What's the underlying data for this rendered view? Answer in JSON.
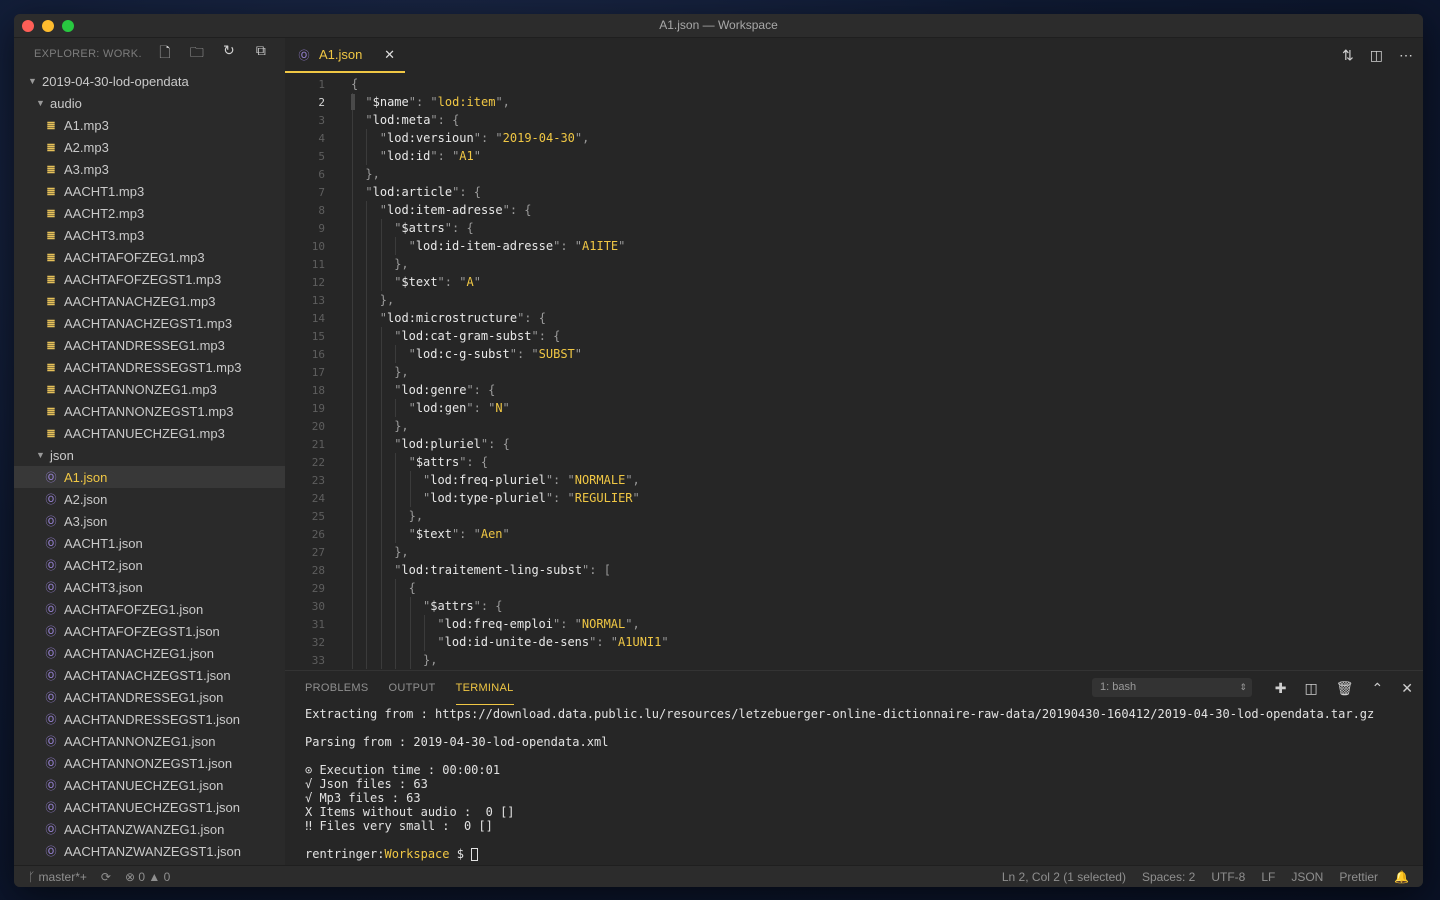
{
  "window": {
    "title": "A1.json — Workspace"
  },
  "sidebar": {
    "header": "EXPLORER: WORK...",
    "root": "2019-04-30-lod-opendata",
    "audio_folder": "audio",
    "audio_files": [
      "A1.mp3",
      "A2.mp3",
      "A3.mp3",
      "AACHT1.mp3",
      "AACHT2.mp3",
      "AACHT3.mp3",
      "AACHTAFOFZEG1.mp3",
      "AACHTAFOFZEGST1.mp3",
      "AACHTANACHZEG1.mp3",
      "AACHTANACHZEGST1.mp3",
      "AACHTANDRESSEG1.mp3",
      "AACHTANDRESSEGST1.mp3",
      "AACHTANNONZEG1.mp3",
      "AACHTANNONZEGST1.mp3",
      "AACHTANUECHZEG1.mp3"
    ],
    "json_folder": "json",
    "json_files": [
      "A1.json",
      "A2.json",
      "A3.json",
      "AACHT1.json",
      "AACHT2.json",
      "AACHT3.json",
      "AACHTAFOFZEG1.json",
      "AACHTAFOFZEGST1.json",
      "AACHTANACHZEG1.json",
      "AACHTANACHZEGST1.json",
      "AACHTANDRESSEG1.json",
      "AACHTANDRESSEGST1.json",
      "AACHTANNONZEG1.json",
      "AACHTANNONZEGST1.json",
      "AACHTANUECHZEG1.json",
      "AACHTANUECHZEGST1.json",
      "AACHTANZWANZEG1.json",
      "AACHTANZWANZEGST1.json"
    ],
    "active_file": "A1.json"
  },
  "editor": {
    "tab_label": "A1.json",
    "current_line": 2,
    "lines": [
      {
        "indent": 0,
        "parts": [
          [
            "p",
            "{"
          ]
        ]
      },
      {
        "indent": 1,
        "parts": [
          [
            "p",
            "\""
          ],
          [
            "k",
            "$name"
          ],
          [
            "p",
            "\": \""
          ],
          [
            "s",
            "lod:item"
          ],
          [
            "p",
            "\","
          ]
        ]
      },
      {
        "indent": 1,
        "parts": [
          [
            "p",
            "\""
          ],
          [
            "k",
            "lod:meta"
          ],
          [
            "p",
            "\": {"
          ]
        ]
      },
      {
        "indent": 2,
        "parts": [
          [
            "p",
            "\""
          ],
          [
            "k",
            "lod:versioun"
          ],
          [
            "p",
            "\": \""
          ],
          [
            "s",
            "2019-04-30"
          ],
          [
            "p",
            "\","
          ]
        ]
      },
      {
        "indent": 2,
        "parts": [
          [
            "p",
            "\""
          ],
          [
            "k",
            "lod:id"
          ],
          [
            "p",
            "\": \""
          ],
          [
            "s",
            "A1"
          ],
          [
            "p",
            "\""
          ]
        ]
      },
      {
        "indent": 1,
        "parts": [
          [
            "p",
            "},"
          ]
        ]
      },
      {
        "indent": 1,
        "parts": [
          [
            "p",
            "\""
          ],
          [
            "k",
            "lod:article"
          ],
          [
            "p",
            "\": {"
          ]
        ]
      },
      {
        "indent": 2,
        "parts": [
          [
            "p",
            "\""
          ],
          [
            "k",
            "lod:item-adresse"
          ],
          [
            "p",
            "\": {"
          ]
        ]
      },
      {
        "indent": 3,
        "parts": [
          [
            "p",
            "\""
          ],
          [
            "k",
            "$attrs"
          ],
          [
            "p",
            "\": {"
          ]
        ]
      },
      {
        "indent": 4,
        "parts": [
          [
            "p",
            "\""
          ],
          [
            "k",
            "lod:id-item-adresse"
          ],
          [
            "p",
            "\": \""
          ],
          [
            "s",
            "A1ITE"
          ],
          [
            "p",
            "\""
          ]
        ]
      },
      {
        "indent": 3,
        "parts": [
          [
            "p",
            "},"
          ]
        ]
      },
      {
        "indent": 3,
        "parts": [
          [
            "p",
            "\""
          ],
          [
            "k",
            "$text"
          ],
          [
            "p",
            "\": \""
          ],
          [
            "s",
            "A"
          ],
          [
            "p",
            "\""
          ]
        ]
      },
      {
        "indent": 2,
        "parts": [
          [
            "p",
            "},"
          ]
        ]
      },
      {
        "indent": 2,
        "parts": [
          [
            "p",
            "\""
          ],
          [
            "k",
            "lod:microstructure"
          ],
          [
            "p",
            "\": {"
          ]
        ]
      },
      {
        "indent": 3,
        "parts": [
          [
            "p",
            "\""
          ],
          [
            "k",
            "lod:cat-gram-subst"
          ],
          [
            "p",
            "\": {"
          ]
        ]
      },
      {
        "indent": 4,
        "parts": [
          [
            "p",
            "\""
          ],
          [
            "k",
            "lod:c-g-subst"
          ],
          [
            "p",
            "\": \""
          ],
          [
            "s",
            "SUBST"
          ],
          [
            "p",
            "\""
          ]
        ]
      },
      {
        "indent": 3,
        "parts": [
          [
            "p",
            "},"
          ]
        ]
      },
      {
        "indent": 3,
        "parts": [
          [
            "p",
            "\""
          ],
          [
            "k",
            "lod:genre"
          ],
          [
            "p",
            "\": {"
          ]
        ]
      },
      {
        "indent": 4,
        "parts": [
          [
            "p",
            "\""
          ],
          [
            "k",
            "lod:gen"
          ],
          [
            "p",
            "\": \""
          ],
          [
            "s",
            "N"
          ],
          [
            "p",
            "\""
          ]
        ]
      },
      {
        "indent": 3,
        "parts": [
          [
            "p",
            "},"
          ]
        ]
      },
      {
        "indent": 3,
        "parts": [
          [
            "p",
            "\""
          ],
          [
            "k",
            "lod:pluriel"
          ],
          [
            "p",
            "\": {"
          ]
        ]
      },
      {
        "indent": 4,
        "parts": [
          [
            "p",
            "\""
          ],
          [
            "k",
            "$attrs"
          ],
          [
            "p",
            "\": {"
          ]
        ]
      },
      {
        "indent": 5,
        "parts": [
          [
            "p",
            "\""
          ],
          [
            "k",
            "lod:freq-pluriel"
          ],
          [
            "p",
            "\": \""
          ],
          [
            "s",
            "NORMALE"
          ],
          [
            "p",
            "\","
          ]
        ]
      },
      {
        "indent": 5,
        "parts": [
          [
            "p",
            "\""
          ],
          [
            "k",
            "lod:type-pluriel"
          ],
          [
            "p",
            "\": \""
          ],
          [
            "s",
            "REGULIER"
          ],
          [
            "p",
            "\""
          ]
        ]
      },
      {
        "indent": 4,
        "parts": [
          [
            "p",
            "},"
          ]
        ]
      },
      {
        "indent": 4,
        "parts": [
          [
            "p",
            "\""
          ],
          [
            "k",
            "$text"
          ],
          [
            "p",
            "\": \""
          ],
          [
            "s",
            "Aen"
          ],
          [
            "p",
            "\""
          ]
        ]
      },
      {
        "indent": 3,
        "parts": [
          [
            "p",
            "},"
          ]
        ]
      },
      {
        "indent": 3,
        "parts": [
          [
            "p",
            "\""
          ],
          [
            "k",
            "lod:traitement-ling-subst"
          ],
          [
            "p",
            "\": ["
          ]
        ]
      },
      {
        "indent": 4,
        "parts": [
          [
            "p",
            "{"
          ]
        ]
      },
      {
        "indent": 5,
        "parts": [
          [
            "p",
            "\""
          ],
          [
            "k",
            "$attrs"
          ],
          [
            "p",
            "\": {"
          ]
        ]
      },
      {
        "indent": 6,
        "parts": [
          [
            "p",
            "\""
          ],
          [
            "k",
            "lod:freq-emploi"
          ],
          [
            "p",
            "\": \""
          ],
          [
            "s",
            "NORMAL"
          ],
          [
            "p",
            "\","
          ]
        ]
      },
      {
        "indent": 6,
        "parts": [
          [
            "p",
            "\""
          ],
          [
            "k",
            "lod:id-unite-de-sens"
          ],
          [
            "p",
            "\": \""
          ],
          [
            "s",
            "A1UNI1"
          ],
          [
            "p",
            "\""
          ]
        ]
      },
      {
        "indent": 5,
        "parts": [
          [
            "p",
            "},"
          ]
        ]
      }
    ]
  },
  "panel": {
    "tabs": [
      "PROBLEMS",
      "OUTPUT",
      "TERMINAL"
    ],
    "active_tab": "TERMINAL",
    "terminal_select": "1: bash",
    "terminal_lines": [
      "Extracting from : https://download.data.public.lu/resources/letzebuerger-online-dictionnaire-raw-data/20190430-160412/2019-04-30-lod-opendata.tar.gz",
      "",
      "Parsing from : 2019-04-30-lod-opendata.xml",
      "",
      "⊙ Execution time : 00:00:01",
      "√ Json files : 63",
      "√ Mp3 files : 63",
      "X Items without audio :  0 []",
      "‼ Files very small :  0 []",
      ""
    ],
    "prompt_user": "rentringer:",
    "prompt_path": "Workspace",
    "prompt_symbol": " $ "
  },
  "statusbar": {
    "branch": "master*+",
    "errors": "0",
    "warnings": "0",
    "position": "Ln 2, Col 2 (1 selected)",
    "spaces": "Spaces: 2",
    "encoding": "UTF-8",
    "eol": "LF",
    "language": "JSON",
    "formatter": "Prettier"
  }
}
